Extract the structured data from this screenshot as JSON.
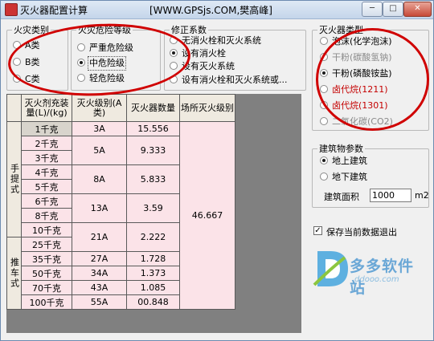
{
  "window": {
    "title": "灭火器配置计算",
    "center_title": "[WWW.GPSjs.COM,樊高峰]",
    "buttons": [
      "─",
      "□",
      "✕"
    ]
  },
  "fire_class": {
    "legend": "火灾类别",
    "options": [
      "A类",
      "B类",
      "C类"
    ],
    "selected": "A类"
  },
  "danger_level": {
    "legend": "火灾危险等级",
    "options": [
      "严重危险级",
      "中危险级",
      "轻危险级"
    ],
    "selected": "中危险级"
  },
  "correction": {
    "legend": "修正系数",
    "options": [
      "无消火栓和灭火系统",
      "设有消火栓",
      "设有灭火系统",
      "设有消火栓和灭火系统或..."
    ],
    "selected": "设有消火栓"
  },
  "extinguisher_type": {
    "legend": "灭火器类型",
    "options": [
      "泡沫(化学泡沫)",
      "干粉(碳酸氢钠)",
      "干粉(磷酸铵盐)",
      "卤代烷(1211)",
      "卤代烷(1301)",
      "二氧化碳(CO2)"
    ],
    "selected": "干粉(磷酸铵盐)"
  },
  "building": {
    "legend": "建筑物参数",
    "options": [
      "地上建筑",
      "地下建筑"
    ],
    "selected": "地上建筑",
    "area_label": "建筑面积",
    "area_value": "1000",
    "unit": "m2"
  },
  "save_checkbox": {
    "label": "保存当前数据退出",
    "checked": true
  },
  "table": {
    "headers": [
      "灭火剂充装量(L)/(kg)",
      "灭火级别(A类)",
      "灭火器数量",
      "场所灭火级别"
    ],
    "group_labels": [
      "手提式",
      "推车式"
    ],
    "rows": [
      {
        "capacity": "1千克",
        "level": "3A",
        "count": "15.556"
      },
      {
        "capacity": "2千克",
        "level": "5A",
        "count": "9.333"
      },
      {
        "capacity": "3千克",
        "level": "",
        "count": ""
      },
      {
        "capacity": "4千克",
        "level": "8A",
        "count": "5.833"
      },
      {
        "capacity": "5千克",
        "level": "",
        "count": ""
      },
      {
        "capacity": "6千克",
        "level": "13A",
        "count": "3.59"
      },
      {
        "capacity": "8千克",
        "level": "",
        "count": ""
      },
      {
        "capacity": "10千克",
        "level": "21A",
        "count": "2.222"
      },
      {
        "capacity": "25千克",
        "level": "",
        "count": ""
      },
      {
        "capacity": "35千克",
        "level": "27A",
        "count": "1.728"
      },
      {
        "capacity": "50千克",
        "level": "34A",
        "count": "1.373"
      },
      {
        "capacity": "70千克",
        "level": "43A",
        "count": "1.085"
      },
      {
        "capacity": "100千克",
        "level": "55A",
        "count": "00.848"
      }
    ],
    "site_level": "46.667"
  },
  "watermark": {
    "brand": "多多软件站",
    "url": "ddooo.com"
  }
}
